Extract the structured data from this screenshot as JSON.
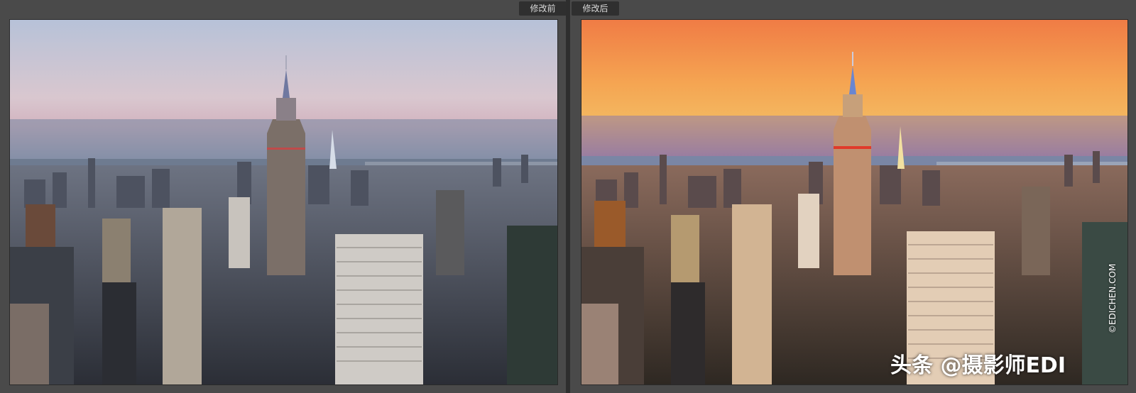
{
  "tabs": {
    "before_label": "修改前",
    "after_label": "修改后"
  },
  "images": {
    "before_alt": "",
    "after_alt": ""
  },
  "watermark": {
    "text": "头条 @摄影师EDI",
    "side_credit": "©EDICHEN.COM"
  },
  "colors": {
    "background": "#4a4a4a",
    "tab_bg": "#2f2f2f",
    "tab_text": "#d8d8d8",
    "before_sky_top": "#b9c3d6",
    "before_sky_bottom": "#d9b9c0",
    "after_sky_top": "#f08a4a",
    "after_sky_bottom": "#f6b65a"
  }
}
